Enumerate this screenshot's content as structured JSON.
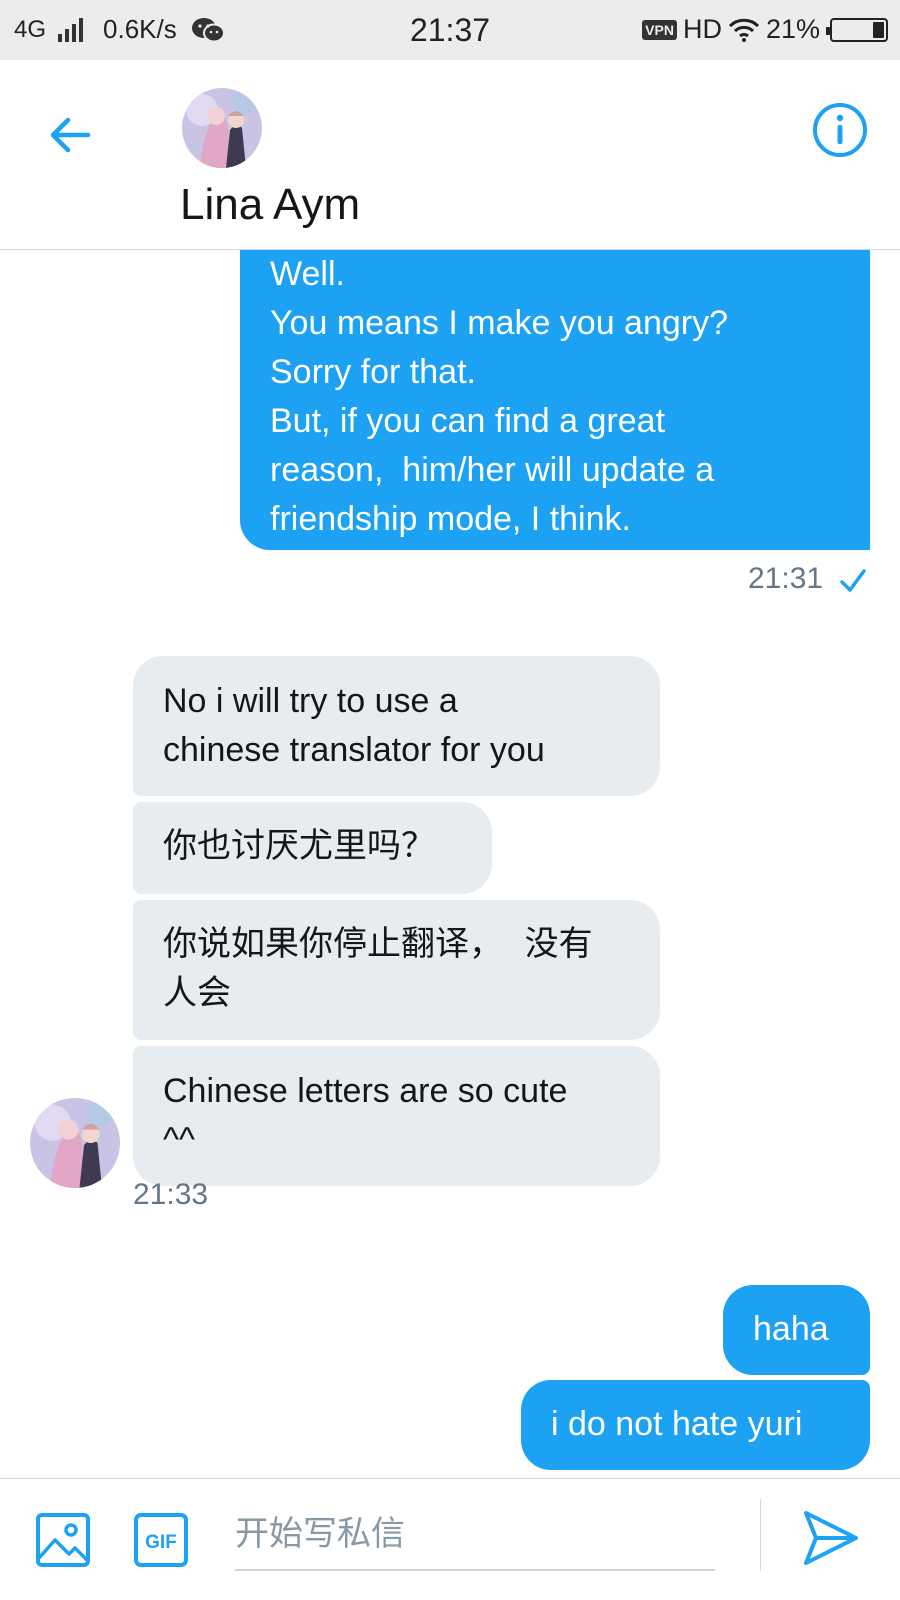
{
  "status_bar": {
    "network": "4G",
    "speed": "0.6K/s",
    "time": "21:37",
    "vpn": "VPN",
    "hd": "HD",
    "battery": "21%",
    "battery_level": 0.21
  },
  "header": {
    "contact_name": "Lina Aym"
  },
  "messages": [
    {
      "direction": "sent",
      "lines": [
        "Well.",
        "You means I make you angry?",
        "Sorry for that.",
        "But, if you can find a great",
        "reason,  him/her will update a",
        "friendship mode, I think."
      ]
    },
    {
      "direction": "recv",
      "lines": [
        "No i will try to use a",
        "chinese translator for you"
      ]
    },
    {
      "direction": "recv",
      "lines": [
        "你也讨厌尤里吗？"
      ]
    },
    {
      "direction": "recv",
      "lines": [
        "你说如果你停止翻译，  没有",
        "人会"
      ]
    },
    {
      "direction": "recv",
      "lines": [
        "Chinese letters are so cute",
        "^^"
      ]
    },
    {
      "direction": "sent",
      "lines": [
        "haha"
      ]
    },
    {
      "direction": "sent",
      "lines": [
        "i do not hate yuri"
      ]
    }
  ],
  "timestamps": {
    "sent_group": "21:31",
    "recv_group": "21:33"
  },
  "composer": {
    "placeholder": "开始写私信",
    "gif_label": "GIF"
  },
  "colors": {
    "accent": "#1da1f2",
    "received_bubble": "#e6ecf0",
    "timestamp": "#657786"
  }
}
